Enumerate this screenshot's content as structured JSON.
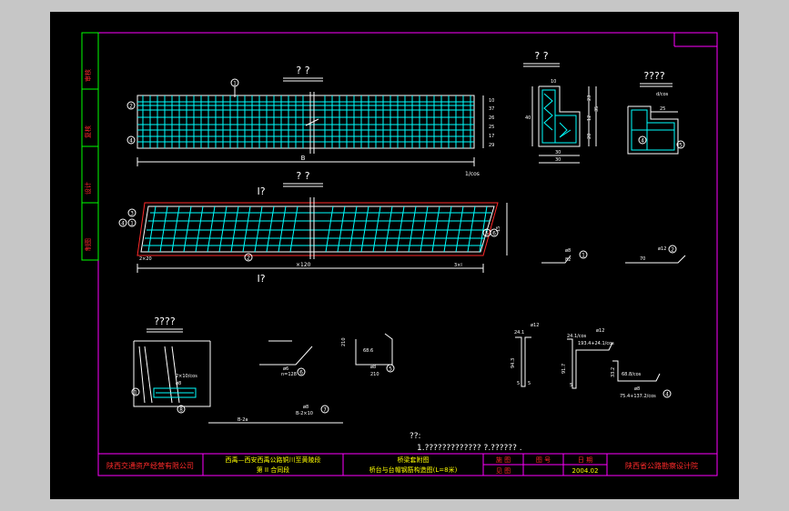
{
  "colors": {
    "background": "#c6c6c6",
    "canvas": "#000000",
    "frame": "#ff00ff",
    "side_strip": "#00ff00",
    "rebar": "#00ffff",
    "outline": "#ffffff",
    "red_line": "#ff2a2a",
    "yellow_text": "#ffff00",
    "title_text": "#ff2a2a"
  },
  "side_strip": [
    "审核",
    "复核",
    "设计",
    "制图"
  ],
  "views": {
    "elevation": {
      "title": "? ?",
      "dim_total": "B",
      "right_note": "1/cos",
      "callouts": [
        "1",
        "2",
        "3",
        "4"
      ],
      "right_dims": [
        "10",
        "37",
        "26",
        "25",
        "17",
        "29"
      ]
    },
    "plan": {
      "title": "? ?",
      "cut_marker": "I?",
      "left_dim": "2×20",
      "mid_dim": "×120",
      "right_dim": "3×l",
      "callouts": [
        "1",
        "2",
        "3",
        "4",
        "5",
        "6"
      ],
      "right_dim_label": "15"
    },
    "section_a": {
      "title": "? ?",
      "dims": [
        "40",
        "10",
        "25",
        "15",
        "23",
        "12",
        "20",
        "35",
        "30",
        "30"
      ]
    },
    "section_b": {
      "title": "????",
      "top_label": "d/cos",
      "dims": [
        "25",
        "17",
        "17",
        "12",
        "4"
      ],
      "callouts": [
        "4",
        "5"
      ]
    },
    "detail_bar1": {
      "label": "ø8",
      "sub": "82",
      "callout": "1"
    },
    "detail_bar2": {
      "label": "ø12",
      "sub": "70",
      "callout": "2"
    },
    "detail_corner": {
      "title": "????",
      "labels": [
        "2×10/cos",
        "ø8"
      ],
      "callouts": [
        "1",
        "8"
      ]
    },
    "detail_hook": {
      "labels": [
        "ø6",
        "n=128"
      ],
      "callout": "6"
    },
    "detail_bar7": {
      "labels": [
        "ø8",
        "B-2×10",
        "B-2a"
      ],
      "callout": "7"
    },
    "detail_stirrup5": {
      "labels": [
        "68.6",
        "210",
        "ø8",
        "210"
      ],
      "callout": "5"
    },
    "detail_u1": {
      "labels": [
        "ø12",
        "24.1",
        "94.3",
        "5",
        "5"
      ]
    },
    "detail_u2": {
      "labels": [
        "ø12",
        "24.1/cos",
        "193.4+24.1/cos",
        "91.7",
        "5"
      ]
    },
    "detail_u3": {
      "labels": [
        "33.2",
        "68.8/cos",
        "ø8",
        "75.4+137.2/cos"
      ],
      "callout": "4"
    }
  },
  "notes": {
    "header": "??:",
    "line1": "1.????????????? ?.?????? ."
  },
  "title_block": {
    "company": "陕西交通资产经营有限公司",
    "project_line1": "西禹—西安西禹公路铜川至黄陵段",
    "project_line2": "第 II 合同段",
    "drawing_line1": "桥梁套附图",
    "drawing_line2": "桥台与台帽钢筋构造图(L=8米)",
    "design_stage": "施 图",
    "sheet_label": "图 号",
    "date_label": "日 期",
    "drawing_no": "见 图",
    "date": "2004.02",
    "institute": "陕西省公路勘察设计院"
  }
}
